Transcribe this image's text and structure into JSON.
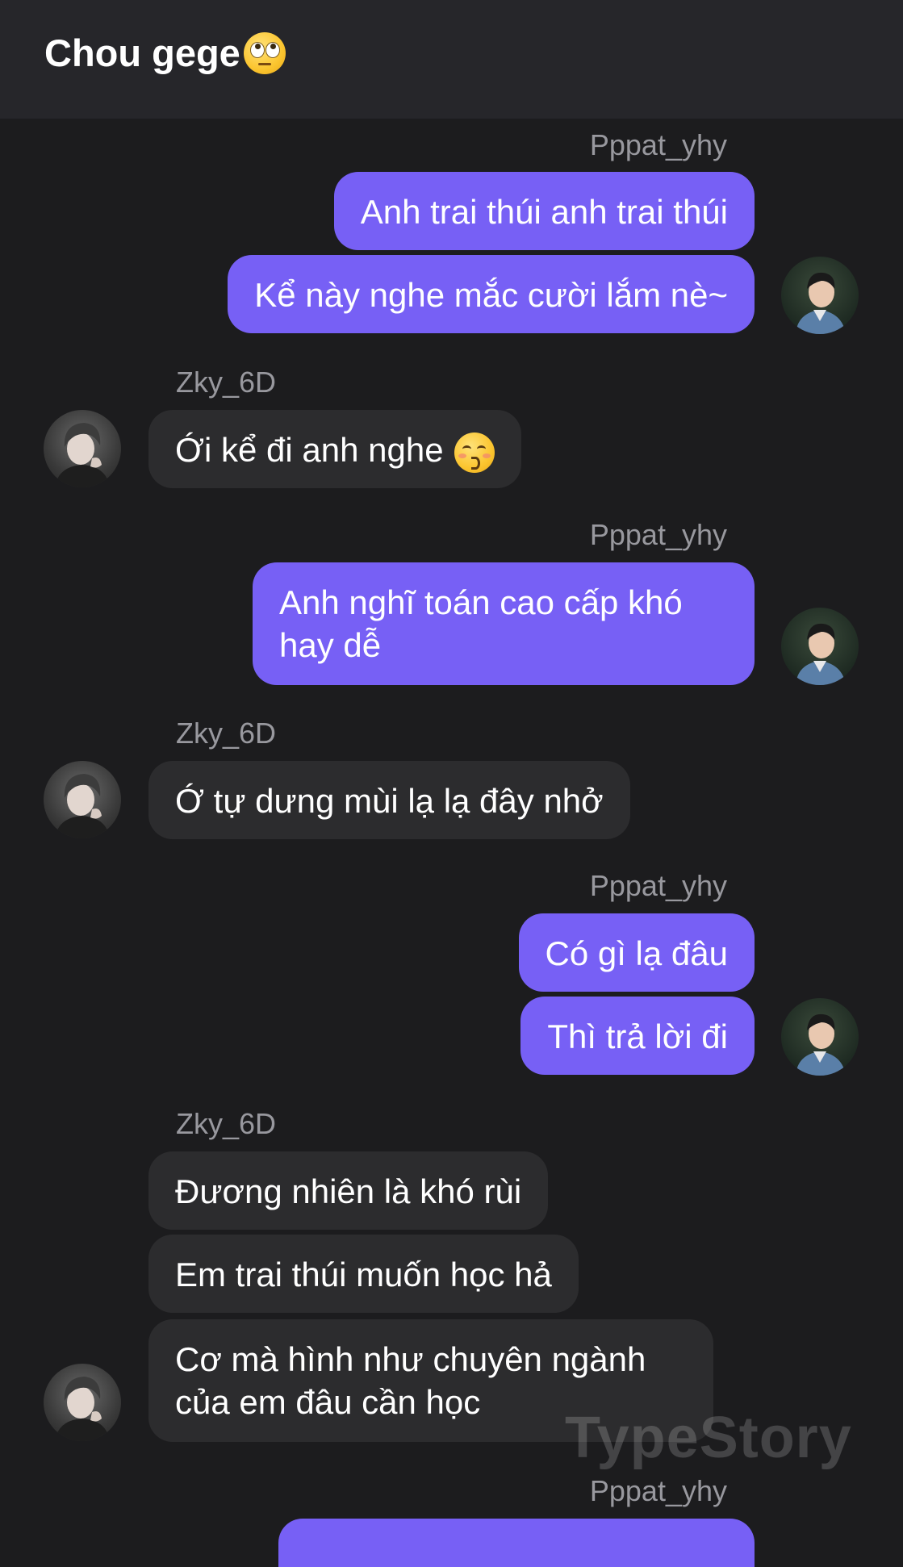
{
  "header": {
    "title": "Chou gege",
    "title_emoji": "face-with-rolling-eyes"
  },
  "participants": {
    "me": "Pppat_yhy",
    "them": "Zky_6D"
  },
  "colors": {
    "background": "#1c1c1e",
    "header_background": "#26262a",
    "my_bubble": "#7760f5",
    "their_bubble": "#2c2c2e",
    "sender_name": "#98989e"
  },
  "messages": [
    {
      "from": "Pppat_yhy",
      "text": "Anh trai thúi anh trai thúi"
    },
    {
      "from": "Pppat_yhy",
      "text": "Kể này nghe mắc cười lắm nè~"
    },
    {
      "from": "Zky_6D",
      "text": "Ới kể đi anh nghe",
      "emoji": "kissing-face-with-closed-eyes"
    },
    {
      "from": "Pppat_yhy",
      "text": "Anh nghĩ toán cao cấp khó hay dễ"
    },
    {
      "from": "Zky_6D",
      "text": "Ớ tự dưng mùi lạ lạ đây nhở"
    },
    {
      "from": "Pppat_yhy",
      "text": "Có gì lạ đâu"
    },
    {
      "from": "Pppat_yhy",
      "text": "Thì trả lời đi"
    },
    {
      "from": "Zky_6D",
      "text": "Đương nhiên là khó rùi"
    },
    {
      "from": "Zky_6D",
      "text": "Em trai thúi muốn học hả"
    },
    {
      "from": "Zky_6D",
      "text": "Cơ mà hình như chuyên ngành của em đâu cần học"
    }
  ],
  "watermark": "TypeStory"
}
